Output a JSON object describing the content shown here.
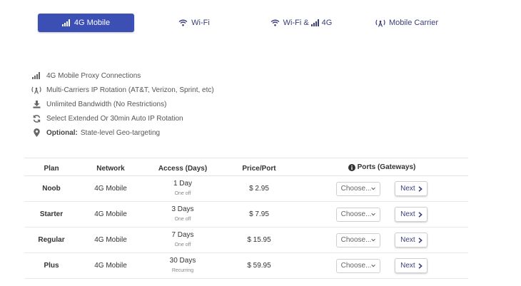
{
  "tabs": [
    {
      "label": "4G Mobile",
      "icon": "signal-bars-icon",
      "active": true
    },
    {
      "label": "Wi-Fi",
      "icon": "wifi-icon",
      "active": false
    },
    {
      "label_a": "Wi-Fi &",
      "label_b": "4G",
      "icon": "wifi-icon",
      "active": false
    },
    {
      "label": "Mobile Carrier",
      "icon": "antenna-icon",
      "active": false
    }
  ],
  "features": [
    {
      "icon": "signal-bars-icon",
      "text": "4G Mobile Proxy Connections"
    },
    {
      "icon": "antenna-icon",
      "text": "Multi-Carriers IP Rotation (AT&T, Verizon, Sprint, etc)"
    },
    {
      "icon": "download-icon",
      "text": "Unlimited Bandwidth (No Restrictions)"
    },
    {
      "icon": "rotate-icon",
      "text": "Select Extended Or 30min Auto IP Rotation"
    },
    {
      "icon": "map-pin-icon",
      "bold": "Optional:",
      "text": "State-level Geo-targeting"
    }
  ],
  "table": {
    "headers": {
      "plan": "Plan",
      "network": "Network",
      "access": "Access (Days)",
      "price": "Price/Port",
      "ports": "Ports (Gateways)"
    },
    "rows": [
      {
        "plan": "Noob",
        "network": "4G Mobile",
        "days": "1 Day",
        "term": "One off",
        "price": "$ 2.95",
        "select": "Choose...",
        "next": "Next"
      },
      {
        "plan": "Starter",
        "network": "4G Mobile",
        "days": "3 Days",
        "term": "One off",
        "price": "$ 7.95",
        "select": "Choose...",
        "next": "Next"
      },
      {
        "plan": "Regular",
        "network": "4G Mobile",
        "days": "7 Days",
        "term": "One off",
        "price": "$ 15.95",
        "select": "Choose...",
        "next": "Next"
      },
      {
        "plan": "Plus",
        "network": "4G Mobile",
        "days": "30 Days",
        "term": "Recurring",
        "price": "$ 59.95",
        "select": "Choose...",
        "next": "Next"
      }
    ]
  },
  "colors": {
    "accent": "#3b4fb5",
    "tab_text": "#3a3f7a"
  }
}
